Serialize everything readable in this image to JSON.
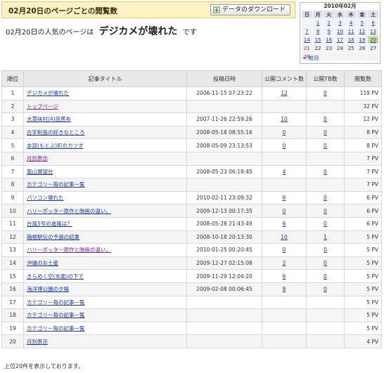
{
  "header": {
    "title": "02月20日のページごとの閲覧数",
    "download_label": "データのダウンロード",
    "download_icon": "download-icon"
  },
  "popular": {
    "prefix": "02月20日の人気のページは",
    "title": "デジカメが壊れた",
    "suffix": "です"
  },
  "calendar": {
    "title": "2010年02月",
    "weekdays": [
      "日",
      "月",
      "火",
      "水",
      "木",
      "金",
      "土"
    ],
    "weeks": [
      [
        "",
        "1",
        "2",
        "3",
        "4",
        "5",
        "6"
      ],
      [
        "7",
        "8",
        "9",
        "10",
        "11",
        "12",
        "13"
      ],
      [
        "14",
        "15",
        "16",
        "17",
        "18",
        "19",
        "20"
      ],
      [
        "21",
        "22",
        "23",
        "24",
        "25",
        "26",
        "27"
      ],
      [
        "28",
        "",
        "",
        "",
        "",
        "",
        ""
      ]
    ],
    "today": "20",
    "prev_label": "< 前月"
  },
  "table": {
    "headers": [
      "順位",
      "記事タイトル",
      "投稿日時",
      "公開コメント数",
      "公開TB数",
      "閲覧数"
    ],
    "rows": [
      {
        "rank": "1",
        "title": "デジカメが壊れた",
        "date": "2006-11-15 07:23:22",
        "comments": "12",
        "tb": "0",
        "views": "119 PV",
        "visited": false
      },
      {
        "rank": "2",
        "title": "トップページ",
        "date": "",
        "comments": "",
        "tb": "",
        "views": "32 PV",
        "visited": true
      },
      {
        "rank": "3",
        "title": "大貫味村(4)芭蕉布",
        "date": "2007-11-26 22:59:26",
        "comments": "10",
        "tb": "0",
        "views": "12 PV",
        "visited": false
      },
      {
        "rank": "4",
        "title": "古宇利島の好きなところ",
        "date": "2008-05-18 08:55:16",
        "comments": "0",
        "tb": "0",
        "views": "8 PV",
        "visited": false
      },
      {
        "rank": "5",
        "title": "本部(もとぶ)町のカツオ",
        "date": "2008-05-09 23:13:53",
        "comments": "0",
        "tb": "0",
        "views": "8 PV",
        "visited": false
      },
      {
        "rank": "6",
        "title": "月別表示",
        "date": "",
        "comments": "",
        "tb": "",
        "views": "7 PV",
        "visited": true
      },
      {
        "rank": "7",
        "title": "嵐山展望台",
        "date": "2008-05-23 06:18:45",
        "comments": "4",
        "tb": "0",
        "views": "7 PV",
        "visited": false
      },
      {
        "rank": "8",
        "title": "カテゴリー毎の記事一覧",
        "date": "",
        "comments": "",
        "tb": "",
        "views": "7 PV",
        "visited": false
      },
      {
        "rank": "9",
        "title": "パソコン壊れた",
        "date": "2010-02-11 23:09:32",
        "comments": "6",
        "tb": "0",
        "views": "6 PV",
        "visited": false
      },
      {
        "rank": "10",
        "title": "ハリーポッター原作と映画の違い。",
        "date": "2009-12-13 00:17:35",
        "comments": "0",
        "tb": "0",
        "views": "6 PV",
        "visited": false
      },
      {
        "rank": "11",
        "title": "台風5号の進路は？",
        "date": "2008-05-28 21:43:49",
        "comments": "6",
        "tb": "0",
        "views": "6 PV",
        "visited": false
      },
      {
        "rank": "12",
        "title": "箱根駅伝の予選の結果",
        "date": "2008-10-18 20:13:30",
        "comments": "10",
        "tb": "1",
        "views": "5 PV",
        "visited": false
      },
      {
        "rank": "13",
        "title": "ハリーポッター原作と映画の違い。",
        "date": "2010-01-25 00:20:45",
        "comments": "0",
        "tb": "0",
        "views": "5 PV",
        "visited": true
      },
      {
        "rank": "14",
        "title": "沖縄のお土産",
        "date": "2009-12-27 02:15:08",
        "comments": "2",
        "tb": "0",
        "views": "5 PV",
        "visited": false
      },
      {
        "rank": "15",
        "title": "きらめく空(水面)の下で",
        "date": "2009-11-29 12:04:20",
        "comments": "6",
        "tb": "0",
        "views": "5 PV",
        "visited": false
      },
      {
        "rank": "16",
        "title": "海洋博公園の夕陽",
        "date": "2009-02-08 00:06:45",
        "comments": "8",
        "tb": "0",
        "views": "5 PV",
        "visited": false
      },
      {
        "rank": "17",
        "title": "カテゴリー毎の記事一覧",
        "date": "",
        "comments": "",
        "tb": "",
        "views": "5 PV",
        "visited": false
      },
      {
        "rank": "18",
        "title": "カテゴリー毎の記事一覧",
        "date": "",
        "comments": "",
        "tb": "",
        "views": "5 PV",
        "visited": false
      },
      {
        "rank": "19",
        "title": "カテゴリー毎の記事一覧",
        "date": "",
        "comments": "",
        "tb": "",
        "views": "5 PV",
        "visited": false
      },
      {
        "rank": "20",
        "title": "月別表示",
        "date": "",
        "comments": "",
        "tb": "",
        "views": "4 PV",
        "visited": false
      }
    ]
  },
  "footnote": "上位20件を表示しております。"
}
